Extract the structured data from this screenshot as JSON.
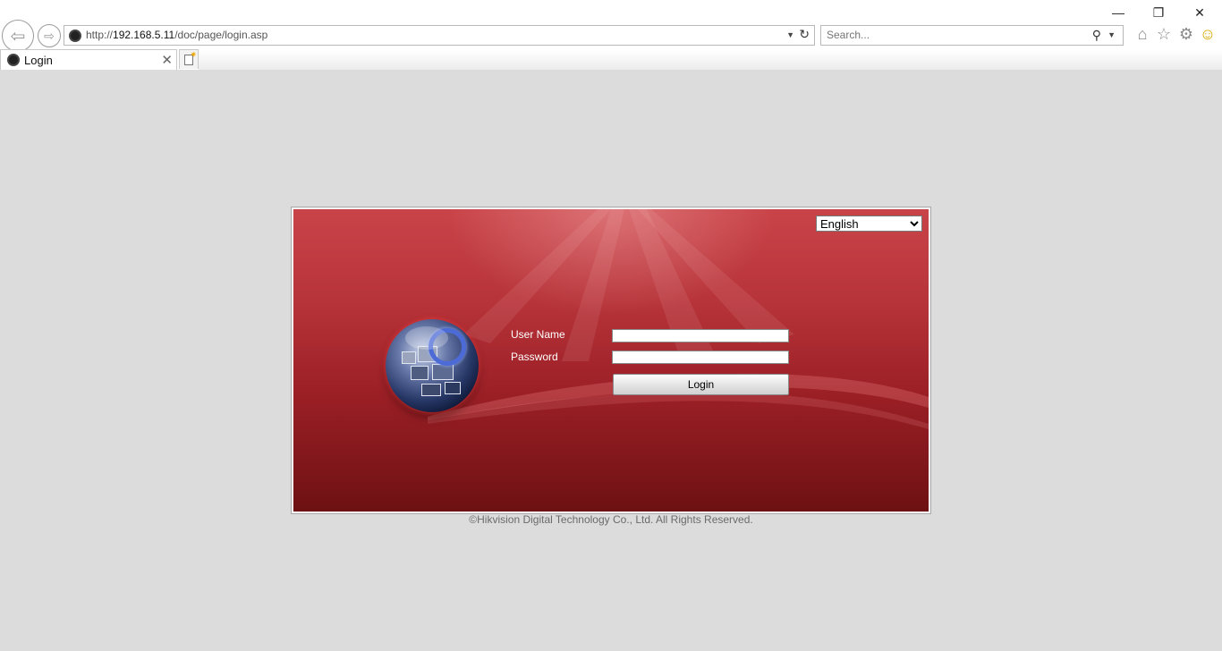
{
  "browser": {
    "window_buttons": {
      "minimize": "—",
      "restore": "❐",
      "close": "✕"
    },
    "address_bar": {
      "protocol": "http://",
      "host": "192.168.5.11",
      "path": "/doc/page/login.asp"
    },
    "search": {
      "placeholder": "Search..."
    },
    "tab": {
      "title": "Login",
      "close": "✕"
    },
    "toolbar_icons": [
      "home-icon",
      "favorites-star-icon",
      "settings-gear-icon",
      "feedback-smiley-icon"
    ]
  },
  "login": {
    "language_selected": "English",
    "language_options": [
      "English"
    ],
    "username_label": "User Name",
    "password_label": "Password",
    "username_value": "",
    "password_value": "",
    "login_button": "Login",
    "accent_color": "#b7343a"
  },
  "footer": {
    "copyright": "©Hikvision Digital Technology Co., Ltd. All Rights Reserved."
  }
}
